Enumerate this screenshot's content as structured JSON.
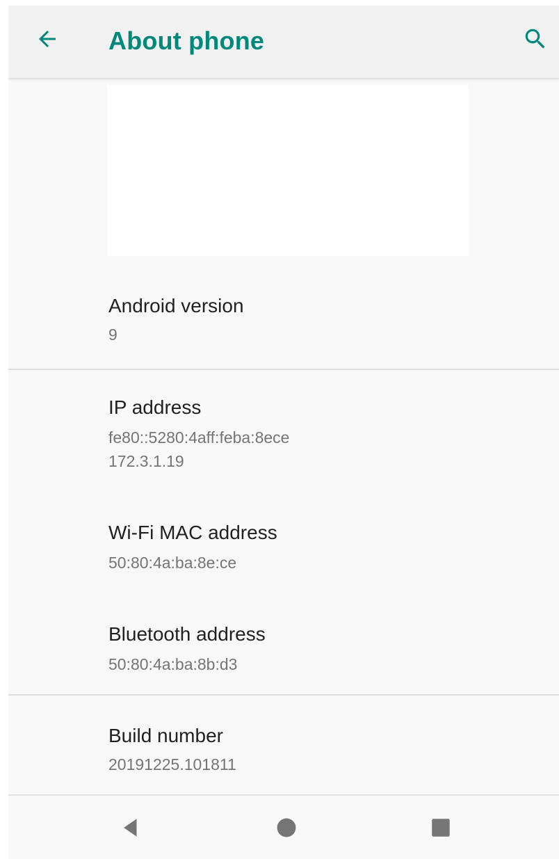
{
  "app_bar": {
    "title": "About phone",
    "back_icon": "arrow-back-icon",
    "search_icon": "search-icon",
    "accent_color": "#00897b"
  },
  "preferences": [
    {
      "title": "Android version",
      "summary": "9"
    },
    {
      "title": "IP address",
      "summary": "fe80::5280:4aff:feba:8ece",
      "summary2": "172.3.1.19"
    },
    {
      "title": "Wi-Fi MAC address",
      "summary": "50:80:4a:ba:8e:ce"
    },
    {
      "title": "Bluetooth address",
      "summary": "50:80:4a:ba:8b:d3"
    },
    {
      "title": "Build number",
      "summary": "20191225.101811"
    }
  ],
  "nav_bar": {
    "back_icon": "triangle-back-icon",
    "home_icon": "circle-home-icon",
    "recents_icon": "square-recents-icon"
  }
}
